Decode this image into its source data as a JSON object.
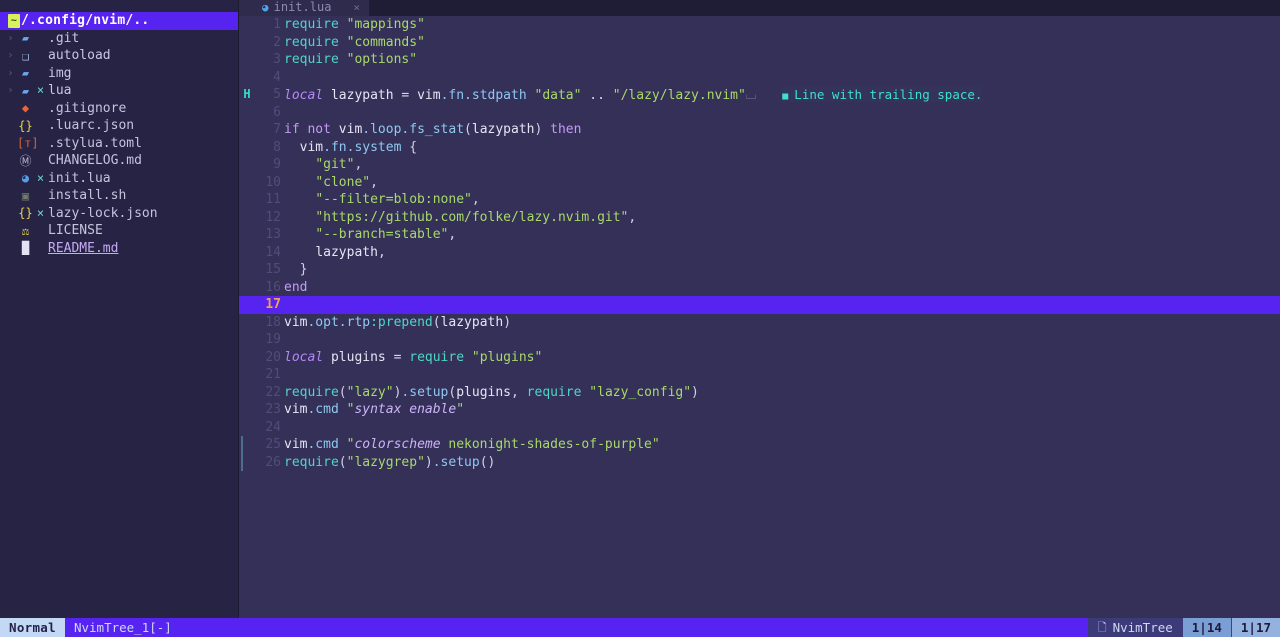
{
  "app": {
    "name": "neovim",
    "colorscheme": "nekonight-shades-of-purple"
  },
  "colors": {
    "sidebar_bg": "#272344",
    "editor_bg": "#343058",
    "cursorline": "#5723f0",
    "accent_purple": "#5723f0",
    "diagnostic_hint": "#3fe0c8",
    "string_green": "#a8d96a",
    "keyword_purple": "#b588f7",
    "function_cyan": "#4fd6c4",
    "linenr": "#514d78",
    "cursor_linenr": "#f0a54a"
  },
  "sidebar": {
    "name": "nvim-tree",
    "root": {
      "badge": "~",
      "label": "/.config/nvim/..",
      "selected": true
    },
    "items": [
      {
        "arrow": "›",
        "icon": "folder-icon",
        "icon_class": "ic-folder",
        "glyph": "▰",
        "modified": "",
        "label": ".git",
        "kind": "dir"
      },
      {
        "arrow": "›",
        "icon": "folder-open-icon",
        "icon_class": "ic-folder-open",
        "glyph": "❑",
        "modified": "",
        "label": "autoload",
        "kind": "dir"
      },
      {
        "arrow": "›",
        "icon": "folder-icon",
        "icon_class": "ic-folder",
        "glyph": "▰",
        "modified": "",
        "label": "img",
        "kind": "dir"
      },
      {
        "arrow": "›",
        "icon": "folder-icon",
        "icon_class": "ic-folder",
        "glyph": "▰",
        "modified": "×",
        "label": "lua",
        "kind": "dir"
      },
      {
        "arrow": "",
        "icon": "gitignore-icon",
        "icon_class": "ic-diamond",
        "glyph": "◆",
        "modified": "",
        "label": ".gitignore",
        "kind": "file"
      },
      {
        "arrow": "",
        "icon": "json-icon",
        "icon_class": "ic-braces",
        "glyph": "{}",
        "modified": "",
        "label": ".luarc.json",
        "kind": "file"
      },
      {
        "arrow": "",
        "icon": "toml-icon",
        "icon_class": "ic-toml",
        "glyph": "[ᴛ]",
        "modified": "",
        "label": ".stylua.toml",
        "kind": "file"
      },
      {
        "arrow": "",
        "icon": "markdown-icon",
        "icon_class": "ic-md",
        "glyph": "Ⓜ",
        "modified": "",
        "label": "CHANGELOG.md",
        "kind": "file"
      },
      {
        "arrow": "",
        "icon": "lua-icon",
        "icon_class": "ic-lua",
        "glyph": "◕",
        "modified": "×",
        "label": "init.lua",
        "kind": "file"
      },
      {
        "arrow": "",
        "icon": "shell-icon",
        "icon_class": "ic-sh",
        "glyph": "▣",
        "modified": "",
        "label": "install.sh",
        "kind": "file"
      },
      {
        "arrow": "",
        "icon": "json-icon",
        "icon_class": "ic-braces",
        "glyph": "{}",
        "modified": "×",
        "label": "lazy-lock.json",
        "kind": "file"
      },
      {
        "arrow": "",
        "icon": "license-icon",
        "icon_class": "ic-license",
        "glyph": "⚖",
        "modified": "",
        "label": "LICENSE",
        "kind": "file"
      },
      {
        "arrow": "",
        "icon": "readme-icon",
        "icon_class": "ic-readme",
        "glyph": "█",
        "modified": "",
        "label": "README.md",
        "kind": "link"
      }
    ]
  },
  "tabline": {
    "tabs": [
      {
        "icon": "lua-icon",
        "glyph": "◕",
        "label": "init.lua",
        "close": "×",
        "active": true
      }
    ]
  },
  "editor": {
    "filename": "init.lua",
    "language": "lua",
    "cursor_line": 17,
    "diagnostic": {
      "sign": "H",
      "sign_line": 5,
      "text": "Line with trailing space.",
      "severity": "hint",
      "marker": "■"
    },
    "lines": [
      {
        "n": 1,
        "tokens": [
          {
            "t": "require",
            "c": "fn-cyan"
          },
          {
            "t": " ",
            "c": "op"
          },
          {
            "t": "\"mappings\"",
            "c": "str"
          }
        ]
      },
      {
        "n": 2,
        "tokens": [
          {
            "t": "require",
            "c": "fn-cyan"
          },
          {
            "t": " ",
            "c": "op"
          },
          {
            "t": "\"commands\"",
            "c": "str"
          }
        ]
      },
      {
        "n": 3,
        "tokens": [
          {
            "t": "require",
            "c": "fn-cyan"
          },
          {
            "t": " ",
            "c": "op"
          },
          {
            "t": "\"options\"",
            "c": "str"
          }
        ]
      },
      {
        "n": 4,
        "tokens": []
      },
      {
        "n": 5,
        "tokens": [
          {
            "t": "local",
            "c": "kw"
          },
          {
            "t": " lazypath ",
            "c": "ident"
          },
          {
            "t": "=",
            "c": "op"
          },
          {
            "t": " vim",
            "c": "ident"
          },
          {
            "t": ".fn",
            "c": "prop"
          },
          {
            "t": ".stdpath",
            "c": "prop"
          },
          {
            "t": " ",
            "c": "op"
          },
          {
            "t": "\"data\"",
            "c": "str"
          },
          {
            "t": " ",
            "c": "op"
          },
          {
            "t": "..",
            "c": "op"
          },
          {
            "t": " ",
            "c": "op"
          },
          {
            "t": "\"/lazy/lazy.nvim\"",
            "c": "str"
          },
          {
            "t": "⌴",
            "c": "trail"
          }
        ]
      },
      {
        "n": 6,
        "tokens": []
      },
      {
        "n": 7,
        "tokens": [
          {
            "t": "if",
            "c": "ctrl"
          },
          {
            "t": " ",
            "c": "op"
          },
          {
            "t": "not",
            "c": "ctrl"
          },
          {
            "t": " vim",
            "c": "ident"
          },
          {
            "t": ".loop",
            "c": "prop"
          },
          {
            "t": ".fs_stat",
            "c": "prop"
          },
          {
            "t": "(",
            "c": "punct"
          },
          {
            "t": "lazypath",
            "c": "ident"
          },
          {
            "t": ")",
            "c": "punct"
          },
          {
            "t": " ",
            "c": "op"
          },
          {
            "t": "then",
            "c": "ctrl"
          }
        ]
      },
      {
        "n": 8,
        "tokens": [
          {
            "t": "  ",
            "c": "indent"
          },
          {
            "t": "vim",
            "c": "ident"
          },
          {
            "t": ".fn",
            "c": "prop"
          },
          {
            "t": ".system",
            "c": "prop"
          },
          {
            "t": " ",
            "c": "op"
          },
          {
            "t": "{",
            "c": "punct"
          }
        ]
      },
      {
        "n": 9,
        "tokens": [
          {
            "t": "    ",
            "c": "indent"
          },
          {
            "t": "\"git\"",
            "c": "str"
          },
          {
            "t": ",",
            "c": "punct"
          }
        ]
      },
      {
        "n": 10,
        "tokens": [
          {
            "t": "    ",
            "c": "indent"
          },
          {
            "t": "\"clone\"",
            "c": "str"
          },
          {
            "t": ",",
            "c": "punct"
          }
        ]
      },
      {
        "n": 11,
        "tokens": [
          {
            "t": "    ",
            "c": "indent"
          },
          {
            "t": "\"--filter=blob:none\"",
            "c": "str"
          },
          {
            "t": ",",
            "c": "punct"
          }
        ]
      },
      {
        "n": 12,
        "tokens": [
          {
            "t": "    ",
            "c": "indent"
          },
          {
            "t": "\"https://github.com/folke/lazy.nvim.git\"",
            "c": "str"
          },
          {
            "t": ",",
            "c": "punct"
          }
        ]
      },
      {
        "n": 13,
        "tokens": [
          {
            "t": "    ",
            "c": "indent"
          },
          {
            "t": "\"--branch=stable\"",
            "c": "str"
          },
          {
            "t": ",",
            "c": "punct"
          }
        ]
      },
      {
        "n": 14,
        "tokens": [
          {
            "t": "    ",
            "c": "indent"
          },
          {
            "t": "lazypath",
            "c": "ident"
          },
          {
            "t": ",",
            "c": "punct"
          }
        ]
      },
      {
        "n": 15,
        "tokens": [
          {
            "t": "  ",
            "c": "indent"
          },
          {
            "t": "}",
            "c": "punct"
          }
        ]
      },
      {
        "n": 16,
        "tokens": [
          {
            "t": "end",
            "c": "ctrl"
          }
        ]
      },
      {
        "n": 17,
        "tokens": []
      },
      {
        "n": 18,
        "tokens": [
          {
            "t": "vim",
            "c": "ident"
          },
          {
            "t": ".opt",
            "c": "prop"
          },
          {
            "t": ".rtp",
            "c": "prop"
          },
          {
            "t": ":prepend",
            "c": "fn-cyan"
          },
          {
            "t": "(",
            "c": "punct"
          },
          {
            "t": "lazypath",
            "c": "ident"
          },
          {
            "t": ")",
            "c": "punct"
          }
        ]
      },
      {
        "n": 19,
        "tokens": []
      },
      {
        "n": 20,
        "tokens": [
          {
            "t": "local",
            "c": "kw"
          },
          {
            "t": " plugins ",
            "c": "ident"
          },
          {
            "t": "=",
            "c": "op"
          },
          {
            "t": " ",
            "c": "op"
          },
          {
            "t": "require",
            "c": "fn-cyan"
          },
          {
            "t": " ",
            "c": "op"
          },
          {
            "t": "\"plugins\"",
            "c": "str"
          }
        ]
      },
      {
        "n": 21,
        "tokens": []
      },
      {
        "n": 22,
        "tokens": [
          {
            "t": "require",
            "c": "fn-cyan"
          },
          {
            "t": "(",
            "c": "punct"
          },
          {
            "t": "\"lazy\"",
            "c": "str"
          },
          {
            "t": ")",
            "c": "punct"
          },
          {
            "t": ".setup",
            "c": "prop"
          },
          {
            "t": "(",
            "c": "punct"
          },
          {
            "t": "plugins",
            "c": "ident"
          },
          {
            "t": ",",
            "c": "punct"
          },
          {
            "t": " ",
            "c": "op"
          },
          {
            "t": "require",
            "c": "fn-cyan"
          },
          {
            "t": " ",
            "c": "op"
          },
          {
            "t": "\"lazy_config\"",
            "c": "str"
          },
          {
            "t": ")",
            "c": "punct"
          }
        ]
      },
      {
        "n": 23,
        "tokens": [
          {
            "t": "vim",
            "c": "ident"
          },
          {
            "t": ".cmd",
            "c": "prop"
          },
          {
            "t": " ",
            "c": "op"
          },
          {
            "t": "\"",
            "c": "str"
          },
          {
            "t": "syntax enable",
            "c": "str-it"
          },
          {
            "t": "\"",
            "c": "str"
          }
        ]
      },
      {
        "n": 24,
        "tokens": []
      },
      {
        "n": 25,
        "tokens": [
          {
            "t": "vim",
            "c": "ident"
          },
          {
            "t": ".cmd",
            "c": "prop"
          },
          {
            "t": " ",
            "c": "op"
          },
          {
            "t": "\"",
            "c": "str"
          },
          {
            "t": "colorscheme",
            "c": "str-it"
          },
          {
            "t": " nekonight-shades-of-purple\"",
            "c": "str"
          }
        ],
        "accent": true
      },
      {
        "n": 26,
        "tokens": [
          {
            "t": "require",
            "c": "fn-cyan"
          },
          {
            "t": "(",
            "c": "punct"
          },
          {
            "t": "\"lazygrep\"",
            "c": "str"
          },
          {
            "t": ")",
            "c": "punct"
          },
          {
            "t": ".setup",
            "c": "prop"
          },
          {
            "t": "()",
            "c": "punct"
          }
        ],
        "accent": true
      }
    ]
  },
  "statusline": {
    "mode": "Normal",
    "file": "NvimTree_1[-]",
    "filetype": "NvimTree",
    "filetype_icon": "὜B",
    "position_left": "1|14",
    "position_right": "1|17"
  }
}
